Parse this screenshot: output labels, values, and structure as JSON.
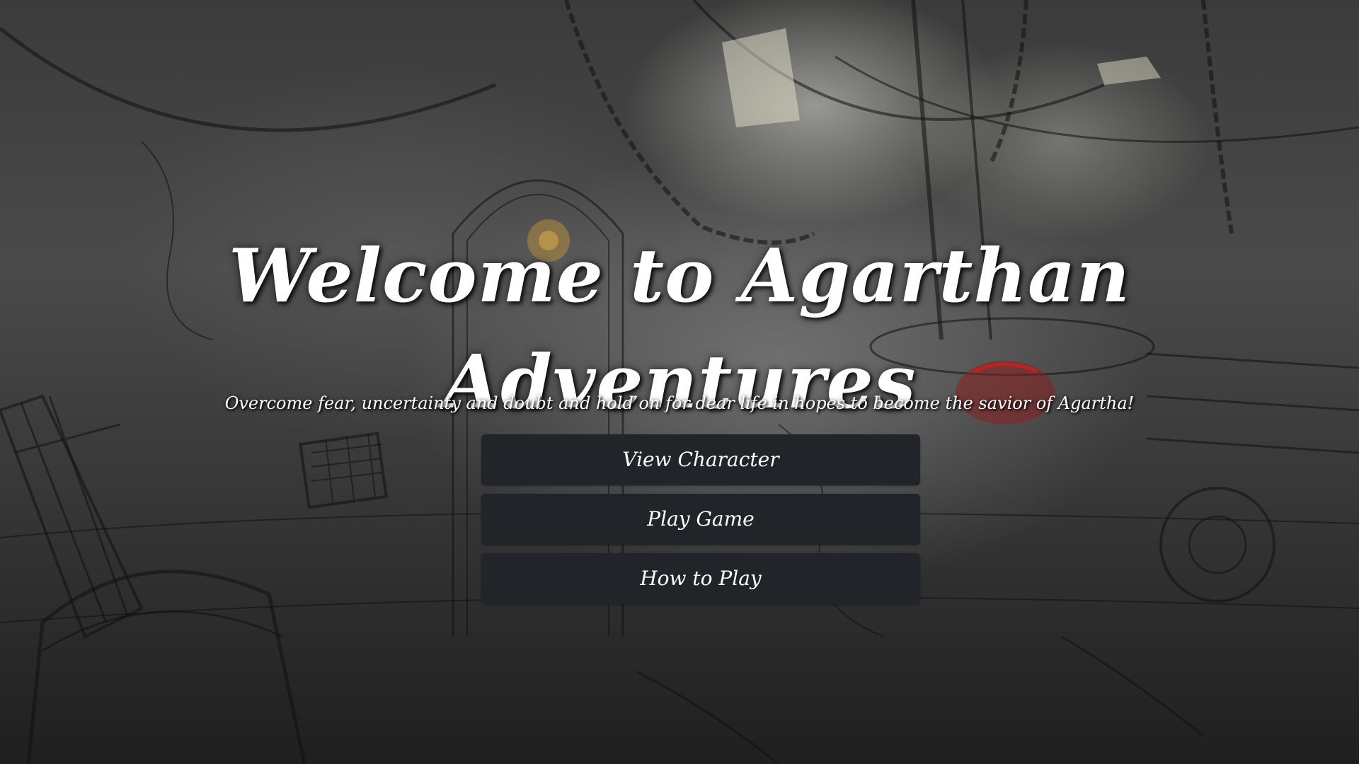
{
  "title": "Welcome to Agarthan Adventures",
  "tagline": "Overcome fear, uncertainty and doubt and hold on for dear life in hopes to become the savior of Agartha!",
  "menu": {
    "items": [
      {
        "label": "View Character"
      },
      {
        "label": "Play Game"
      },
      {
        "label": "How to Play"
      }
    ]
  },
  "colors": {
    "button_background": "#212429",
    "button_text": "#ffffff",
    "title_text": "#ffffff",
    "background_tone": "#3b3b3b"
  },
  "background": {
    "description_icon": "sketch-interior-illustration"
  }
}
